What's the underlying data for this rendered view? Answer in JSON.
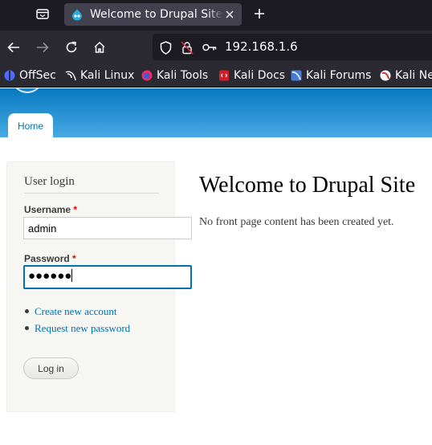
{
  "browser": {
    "tab": {
      "title": "Welcome to Drupal Site | Drupal"
    },
    "url": "192.168.1.6",
    "bookmarks": [
      {
        "label": "OffSec",
        "icon": "offsec-icon",
        "color": "#4d6bff"
      },
      {
        "label": "Kali Linux",
        "icon": "kali-dragon-icon",
        "color": "#ffffff"
      },
      {
        "label": "Kali Tools",
        "icon": "kali-tools-icon",
        "color": "#e0306a"
      },
      {
        "label": "Kali Docs",
        "icon": "kali-docs-icon",
        "color": "#d21f27"
      },
      {
        "label": "Kali Forums",
        "icon": "kali-forums-icon",
        "color": "#4b7bd8"
      },
      {
        "label": "Kali NetHunter",
        "icon": "kali-nethunter-icon",
        "color": "#d22d39"
      }
    ]
  },
  "site": {
    "nav": {
      "home_label": "Home"
    },
    "login": {
      "title": "User login",
      "username_label": "Username",
      "username_value": "admin",
      "password_label": "Password",
      "password_value": "●●●●●●",
      "required_mark": "*",
      "links": [
        "Create new account",
        "Request new password"
      ],
      "submit_label": "Log in"
    },
    "main": {
      "title": "Welcome to Drupal Site",
      "message": "No front page content has been created yet."
    }
  },
  "colors": {
    "header_gradient_top": "#0779bf",
    "header_gradient_bottom": "#48a9e4",
    "link": "#0071b3",
    "focus_border": "#0071b3",
    "required": "#ee0000"
  }
}
